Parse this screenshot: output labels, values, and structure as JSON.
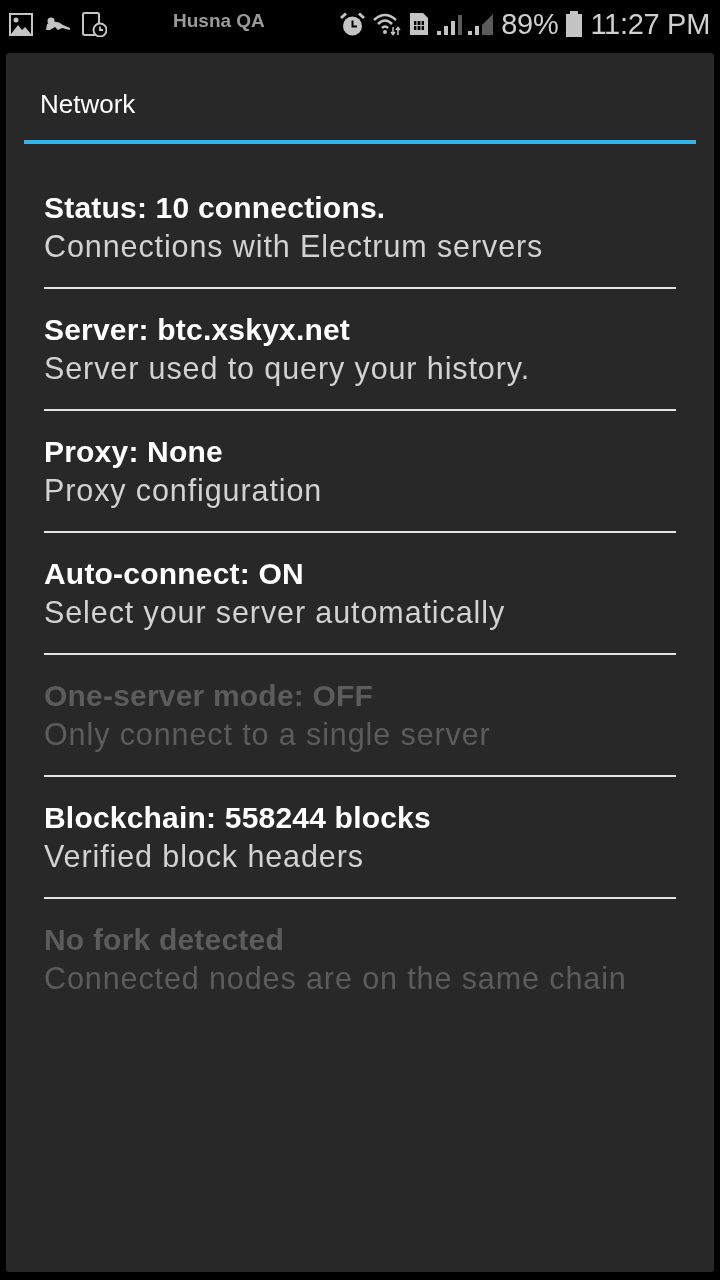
{
  "status_bar": {
    "carrier": "Husna QA",
    "battery": "89%",
    "time": "11:27 PM"
  },
  "dialog": {
    "title": "Network",
    "items": [
      {
        "title": "Status: 10 connections.",
        "summary": "Connections with Electrum servers",
        "disabled": false
      },
      {
        "title": "Server: btc.xskyx.net",
        "summary": "Server used to query your history.",
        "disabled": false
      },
      {
        "title": "Proxy: None",
        "summary": "Proxy configuration",
        "disabled": false
      },
      {
        "title": "Auto-connect: ON",
        "summary": "Select your server automatically",
        "disabled": false
      },
      {
        "title": "One-server mode: OFF",
        "summary": "Only connect to a single server",
        "disabled": true
      },
      {
        "title": "Blockchain: 558244 blocks",
        "summary": "Verified block headers",
        "disabled": false
      },
      {
        "title": "No fork detected",
        "summary": "Connected nodes are on the same chain",
        "disabled": true
      }
    ]
  }
}
